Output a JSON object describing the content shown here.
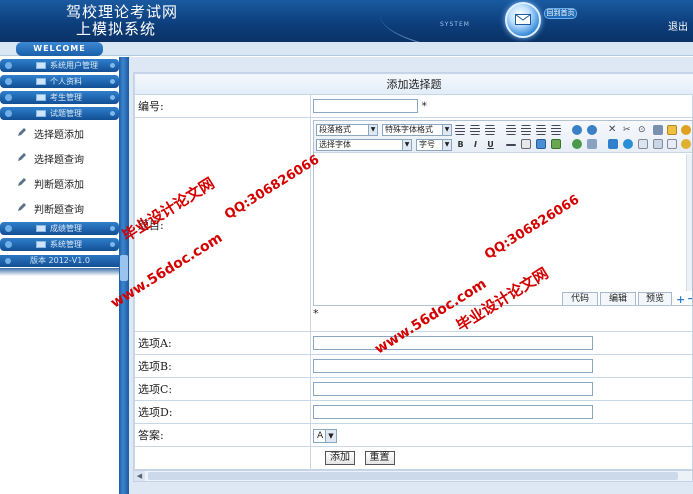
{
  "header": {
    "title_line1": "驾校理论考试网",
    "title_line2": "上模拟系统",
    "system_text": "SYSTEM",
    "homepage_label": "回到首页",
    "exit_label": "退出"
  },
  "welcome": {
    "label": "WELCOME"
  },
  "sidebar": {
    "menus": [
      {
        "label": "系统用户管理"
      },
      {
        "label": "个人资料"
      },
      {
        "label": "考生管理"
      },
      {
        "label": "试题管理"
      }
    ],
    "sub_items": [
      {
        "label": "选择题添加"
      },
      {
        "label": "选择题查询"
      },
      {
        "label": "判断题添加"
      },
      {
        "label": "判断题查询"
      }
    ],
    "menus_after": [
      {
        "label": "成绩管理"
      },
      {
        "label": "系统管理"
      }
    ],
    "version": "版本 2012-V1.0"
  },
  "form": {
    "title": "添加选择题",
    "number_label": "编号:",
    "number_value": "",
    "required_mark": "*",
    "question_label": "题目:",
    "editor": {
      "paragraph_format": "段落格式",
      "special_font_format": "特殊字体格式",
      "font_select": "选择字体",
      "font_size": "字号",
      "bold": "B",
      "italic": "I",
      "underline": "U",
      "tab_code": "代码",
      "tab_edit": "编辑",
      "tab_preview": "预览"
    },
    "option_a_label": "选项A:",
    "option_b_label": "选项B:",
    "option_c_label": "选项C:",
    "option_d_label": "选项D:",
    "answer_label": "答案:",
    "answer_value": "A",
    "add_button": "添加",
    "reset_button": "重置"
  },
  "watermarks": {
    "brand": "毕业设计论文网",
    "qq": "QQ:306826066",
    "site": "www.56doc.com"
  },
  "colors": {
    "header_blue": "#0d3f7d",
    "sidebar_blue": "#1a5fa8",
    "watermark_red": "#d40000"
  }
}
